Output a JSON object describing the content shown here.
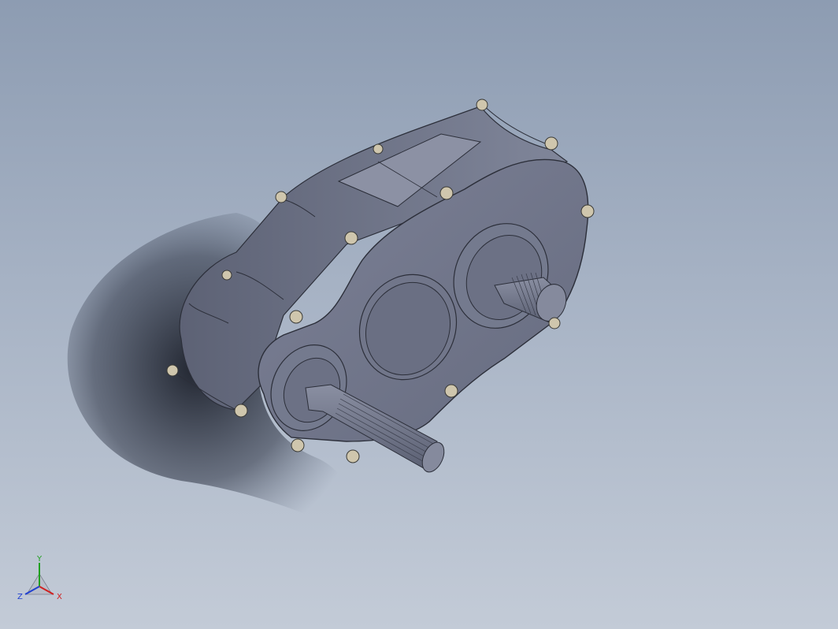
{
  "viewport": {
    "background_top": "#8d9cb2",
    "background_bottom": "#c3cbd7"
  },
  "model": {
    "body_color": "#6e7387",
    "edge_color": "#2c2f3a",
    "bolt_color": "#cfc6ad"
  },
  "triad": {
    "x_label": "X",
    "y_label": "Y",
    "z_label": "Z",
    "x_color": "#d02020",
    "y_color": "#20a020",
    "z_color": "#2040d0"
  }
}
